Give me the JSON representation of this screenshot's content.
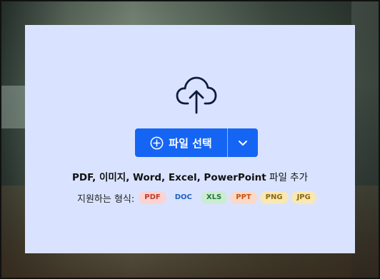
{
  "upload": {
    "button_label": "파일 선택",
    "add_text": {
      "formats": "PDF, 이미지, Word, Excel, PowerPoint",
      "suffix": " 파일 추가"
    },
    "supported_label": "지원하는 형식:",
    "formats": [
      {
        "label": "PDF",
        "bg": "#fbd3d3",
        "fg": "#c0392b"
      },
      {
        "label": "DOC",
        "bg": "#d9e3ff",
        "fg": "#1f5fbf"
      },
      {
        "label": "XLS",
        "bg": "#cdebd3",
        "fg": "#1e7a3a"
      },
      {
        "label": "PPT",
        "bg": "#fbd9c6",
        "fg": "#c4551a"
      },
      {
        "label": "PNG",
        "bg": "#f9e7b4",
        "fg": "#8a6a12"
      },
      {
        "label": "JPG",
        "bg": "#f9e7b4",
        "fg": "#8a6a12"
      }
    ]
  },
  "icons": {
    "upload": "cloud-upload-icon",
    "add": "plus-circle-icon",
    "dropdown": "chevron-down-icon"
  },
  "colors": {
    "dropzone_bg": "#d9e3ff",
    "primary": "#1565f5",
    "icon": "#0d1b3e"
  }
}
